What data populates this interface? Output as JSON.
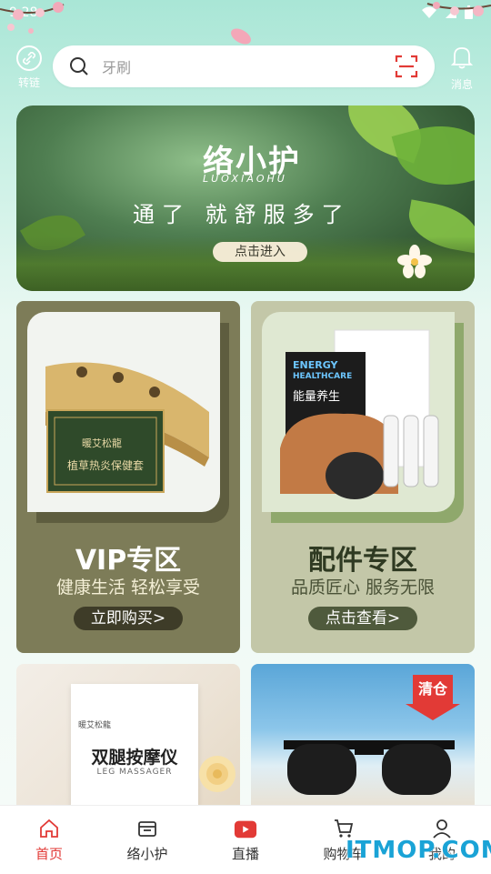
{
  "status_bar": {
    "time": "9:28"
  },
  "header": {
    "left": {
      "label": "转链",
      "icon": "link-icon"
    },
    "search": {
      "placeholder": "牙刷"
    },
    "right": {
      "label": "消息",
      "icon": "bell-icon"
    }
  },
  "banner": {
    "brand": "络小护",
    "brand_sub": "LUOXIAOHU",
    "slogan": "通了 就舒服多了",
    "button": "点击进入"
  },
  "promos": [
    {
      "title": "VIP专区",
      "subtitle": "健康生活 轻松享受",
      "cta": "立即购买>",
      "box_text_1": "暖艾松龍",
      "box_text_2": "植草热炎保健套"
    },
    {
      "title": "配件专区",
      "subtitle": "品质匠心 服务无限",
      "cta": "点击查看>",
      "box_text_1": "ENERGY",
      "box_text_2": "HEALTHCARE",
      "box_text_3": "能量养生"
    }
  ],
  "products": [
    {
      "title": "双腿按摩仪",
      "subtitle": "LEG MASSAGER",
      "logo": "暖艾松龍"
    },
    {
      "tag": "清仓"
    }
  ],
  "bottom_nav": [
    {
      "label": "首页",
      "icon": "home-icon",
      "active": true
    },
    {
      "label": "络小护",
      "icon": "store-icon",
      "active": false
    },
    {
      "label": "直播",
      "icon": "live-tv-icon",
      "active": false
    },
    {
      "label": "购物车",
      "icon": "cart-icon",
      "active": false
    },
    {
      "label": "我的",
      "icon": "user-icon",
      "active": false
    }
  ],
  "watermark": "ITMOP.COM",
  "colors": {
    "accent": "#e23a36",
    "vip_card": "#7d7c58",
    "accessory_card": "#c3c7a8"
  }
}
